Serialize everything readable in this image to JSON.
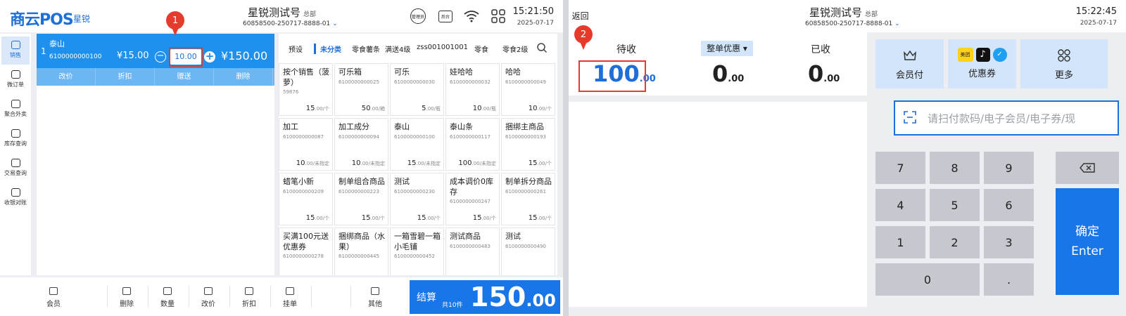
{
  "left_screen": {
    "header": {
      "logo": "商云POS",
      "logo_sub": "星锐",
      "store_name": "星锐测试号",
      "store_tag": "总部",
      "store_id": "60858500-250717-8888-01",
      "manager_icon_label": "管理员",
      "backoffice_icon_label": "后台",
      "time": "15:21:50",
      "date": "2025-07-17"
    },
    "sidebar": [
      {
        "label": "销售",
        "icon": "sales-icon",
        "active": true
      },
      {
        "label": "微订单",
        "icon": "order-icon"
      },
      {
        "label": "聚合外卖",
        "icon": "delivery-icon"
      },
      {
        "label": "库存查询",
        "icon": "inventory-icon"
      },
      {
        "label": "交易查询",
        "icon": "transaction-icon"
      },
      {
        "label": "收银对账",
        "icon": "reconcile-icon"
      }
    ],
    "cart": {
      "line_no": "1",
      "name": "泰山",
      "code": "6100000000100",
      "unit_price": "¥15.00",
      "qty": "10.00",
      "line_total": "¥150.00",
      "ops": [
        "改价",
        "折扣",
        "赠送",
        "删除"
      ]
    },
    "categories": [
      "预设",
      "未分类",
      "零食薯条",
      "满送4级",
      "zss001001001",
      "零食",
      "零食2级"
    ],
    "active_category": "未分类",
    "products": [
      {
        "name": "按个销售（菠萝）",
        "code": "59876",
        "price": "15",
        "dec": ".00",
        "unit": "/个"
      },
      {
        "name": "可乐箱",
        "code": "6100000000025",
        "price": "50",
        "dec": ".00",
        "unit": "/箱"
      },
      {
        "name": "可乐",
        "code": "6100000000030",
        "price": "5",
        "dec": ".00",
        "unit": "/瓶"
      },
      {
        "name": "娃哈哈",
        "code": "6100000000032",
        "price": "10",
        "dec": ".00",
        "unit": "/瓶"
      },
      {
        "name": "哈哈",
        "code": "6100000000049",
        "price": "10",
        "dec": ".00",
        "unit": "/个"
      },
      {
        "name": "加工",
        "code": "6100000000087",
        "price": "10",
        "dec": ".00",
        "unit": "/未指定"
      },
      {
        "name": "加工成分",
        "code": "6100000000094",
        "price": "10",
        "dec": ".00",
        "unit": "/未指定"
      },
      {
        "name": "泰山",
        "code": "6100000000100",
        "price": "15",
        "dec": ".00",
        "unit": "/未指定"
      },
      {
        "name": "泰山条",
        "code": "6100000000117",
        "price": "100",
        "dec": ".00",
        "unit": "/未指定"
      },
      {
        "name": "捆绑主商品",
        "code": "6100000000193",
        "price": "15",
        "dec": ".00",
        "unit": "/个"
      },
      {
        "name": "蜡笔小新",
        "code": "6100000000209",
        "price": "15",
        "dec": ".00",
        "unit": "/个"
      },
      {
        "name": "制单组合商品",
        "code": "6100000000223",
        "price": "15",
        "dec": ".00",
        "unit": "/个"
      },
      {
        "name": "测试",
        "code": "6100000000230",
        "price": "15",
        "dec": ".00",
        "unit": "/个"
      },
      {
        "name": "成本调价0库存",
        "code": "6100000000247",
        "price": "15",
        "dec": ".00",
        "unit": "/个"
      },
      {
        "name": "制单拆分商品",
        "code": "6100000000261",
        "price": "15",
        "dec": ".00",
        "unit": "/个"
      },
      {
        "name": "买满100元送优惠券",
        "code": "6100000000278",
        "price": "",
        "dec": "",
        "unit": ""
      },
      {
        "name": "捆绑商品（水果）",
        "code": "6100000000445",
        "price": "",
        "dec": "",
        "unit": ""
      },
      {
        "name": "一箱雪碧一箱小毛铺",
        "code": "6100000000452",
        "price": "",
        "dec": "",
        "unit": ""
      },
      {
        "name": "测试商品",
        "code": "6100000000483",
        "price": "",
        "dec": "",
        "unit": ""
      },
      {
        "name": "测试",
        "code": "6100000000490",
        "price": "",
        "dec": "",
        "unit": ""
      }
    ],
    "bottom_bar": [
      {
        "label": "会员",
        "icon": "member-icon"
      },
      {
        "label": "删除",
        "icon": "delete-icon"
      },
      {
        "label": "数量",
        "icon": "quantity-icon"
      },
      {
        "label": "改价",
        "icon": "price-change-icon"
      },
      {
        "label": "折扣",
        "icon": "discount-icon"
      },
      {
        "label": "挂单",
        "icon": "hold-order-icon"
      },
      {
        "label": "其他",
        "icon": "more-icon"
      }
    ],
    "checkout": {
      "label": "结算",
      "count": "共10件",
      "amount": "150",
      "decimal": ".00"
    },
    "marker": "1"
  },
  "right_screen": {
    "header": {
      "back_label": "返回",
      "store_name": "星锐测试号",
      "store_tag": "总部",
      "store_id": "60858500-250717-8888-01",
      "time": "15:22:45",
      "date": "2025-07-17"
    },
    "summary": {
      "due_label": "待收",
      "due_value": "100",
      "due_decimal": ".00",
      "discount_label": "整单优惠",
      "discount_value": "0",
      "discount_decimal": ".00",
      "received_label": "已收",
      "received_value": "0",
      "received_decimal": ".00"
    },
    "pay_methods": [
      {
        "label": "会员付",
        "icon": "member-pay-icon"
      },
      {
        "label": "优惠券",
        "icon": "coupon-icon",
        "badge": "美团"
      },
      {
        "label": "更多",
        "icon": "more-grid-icon"
      }
    ],
    "pay_input_placeholder": "请扫付款码/电子会员/电子券/现",
    "keypad": [
      "7",
      "8",
      "9",
      "4",
      "5",
      "6",
      "1",
      "2",
      "3",
      "0",
      "."
    ],
    "enter": {
      "line1": "确定",
      "line2": "Enter"
    },
    "marker": "2"
  },
  "colors": {
    "accent": "#1976e8",
    "cart_row": "#2090ee",
    "marker": "#e53a2c"
  }
}
